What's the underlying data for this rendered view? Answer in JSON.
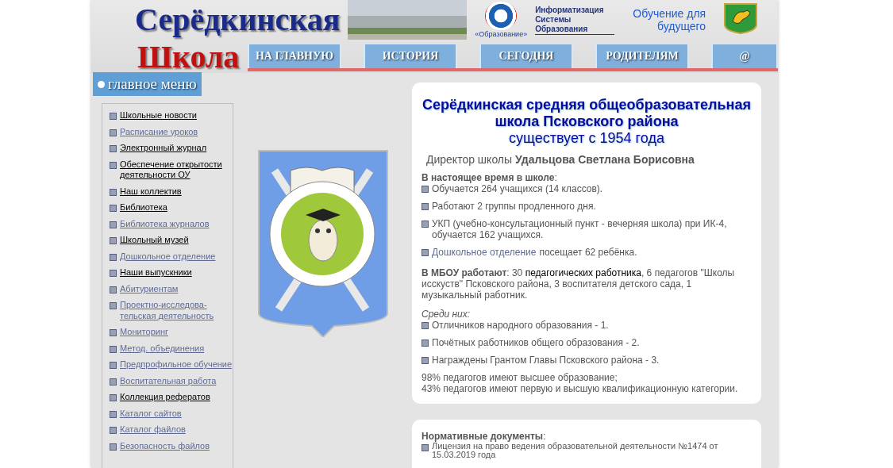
{
  "header": {
    "title_line1": "Серёдкинская",
    "title_line2": "Школа",
    "logos": [
      {
        "kind": "priority",
        "text": "«Образование»"
      },
      {
        "kind": "iso",
        "text": "Информатизация Системы Образования"
      },
      {
        "kind": "intel",
        "text": "Обучение для будущего"
      }
    ]
  },
  "nav": [
    {
      "label": "НА ГЛАВНУЮ"
    },
    {
      "label": "ИСТОРИЯ"
    },
    {
      "label": "СЕГОДНЯ"
    },
    {
      "label": "РОДИТЕЛЯМ"
    },
    {
      "label": "@"
    }
  ],
  "sidebar": {
    "heading": "главное меню",
    "items": [
      {
        "label": "Школьные новости",
        "visited": false
      },
      {
        "label": "Расписание уроков",
        "visited": true
      },
      {
        "label": "Электронный журнал",
        "visited": false
      },
      {
        "label": "Обеспечение открытости деятельности ОУ",
        "visited": false
      },
      {
        "label": "Наш коллектив",
        "visited": false
      },
      {
        "label": "Библиотека",
        "visited": false
      },
      {
        "label": "Библиотека журналов",
        "visited": true
      },
      {
        "label": "Школьный музей",
        "visited": false
      },
      {
        "label": "Дошкольное отделение",
        "visited": true
      },
      {
        "label": "Наши выпускники",
        "visited": false
      },
      {
        "label": "Абитуриентам",
        "visited": true
      },
      {
        "label": "Проектно-исследова-тельская деятельность",
        "visited": true
      },
      {
        "label": "Мониторинг",
        "visited": true
      },
      {
        "label": "Метод. объединения",
        "visited": true
      },
      {
        "label": "Предпрофильное обучение",
        "visited": true
      },
      {
        "label": "Воспитательная работа",
        "visited": true
      },
      {
        "label": "Коллекция рефератов",
        "visited": false
      },
      {
        "label": "Каталог сайтов",
        "visited": true
      },
      {
        "label": "Каталог файлов",
        "visited": true
      },
      {
        "label": "Безопасность файлов",
        "visited": true
      }
    ]
  },
  "about": {
    "title": "Серёдкинская средняя общеобразовательная школа Псковского района",
    "subtitle": "существует с 1954 года",
    "director": "Директор школы **Удальцова Светлана Борисовна**",
    "now_heading": "**В настоящее время в школе**:",
    "now_items": [
      {
        "text": "Обучается 264 учащихся (14 классов)."
      },
      {
        "text": "Работают 2 группы продленного дня."
      },
      {
        "text": "УКП (учебно-консультационный пункт - вечерняя школа) при ИК-4, обучается 162 учащихся."
      },
      {
        "link": "Дошкольное отделение",
        "text": "посещает 62 ребёнка."
      }
    ],
    "staff": {
      "prefix": "**В МБОУ работают**: 30 ",
      "link": "педагогических работника",
      "suffix": ", 6 педагогов \"Школы исскуств\" Псковского района, 3 воспитателя детского сада, 1 музыкальный работник."
    },
    "among_heading": "Среди них:",
    "among_items": [
      "Отличников народного образования - 1.",
      "Почётных работников общего образования - 2.",
      "Награждены Грантом Главы Псковского района - 3."
    ],
    "summary": [
      "98% педагогов имеют высшее образование;",
      "43% педагогов имеют первую и высшую квалификационную категории."
    ]
  },
  "documents": {
    "heading": "**Нормативные документы**:",
    "items": [
      "Лицензия на право ведения образовательной деятельности №1474 от 15.03.2019 года"
    ]
  }
}
